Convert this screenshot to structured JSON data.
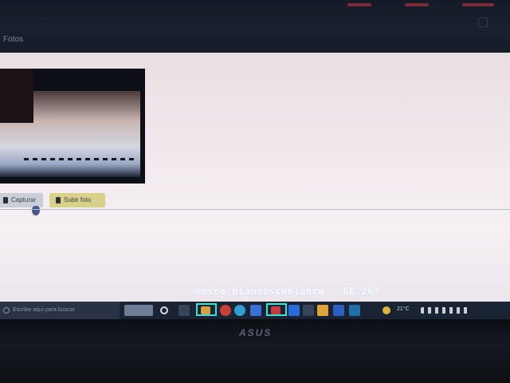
{
  "window": {
    "tab_title": "Fotos",
    "faint_text": "..."
  },
  "page": {
    "capture_button": "Capturar",
    "upload_button": "Subir foto"
  },
  "detection": {
    "label": "mosca blanmoscablanca : 60.267",
    "box_color": "#3fe0d6"
  },
  "taskbar": {
    "search_placeholder": "Escribe aquí para buscar",
    "weather": "21°C",
    "icons": [
      "task-view-icon",
      "file-explorer-icon",
      "chrome-icon",
      "edge-icon",
      "store-icon",
      "vscode-icon",
      "powerpoint-icon",
      "word-icon",
      "terminal-icon"
    ]
  },
  "bezel": {
    "brand": "ASUS"
  }
}
